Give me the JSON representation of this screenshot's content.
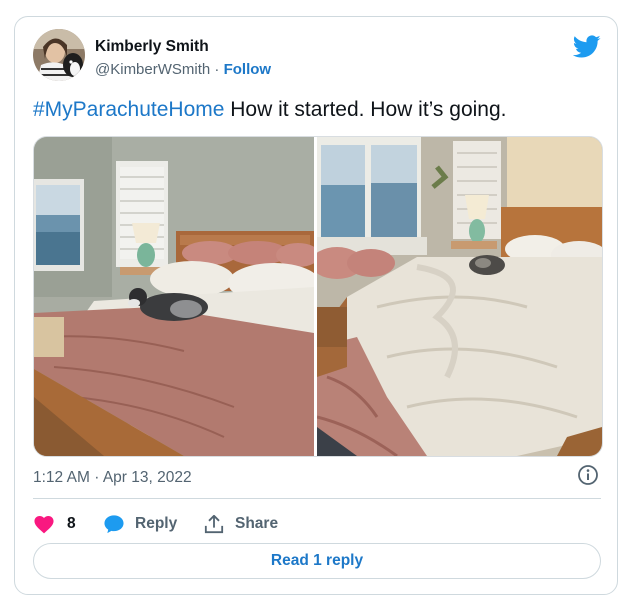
{
  "author": {
    "name": "Kimberly Smith",
    "handle": "@KimberWSmith",
    "separator": "·",
    "follow_label": "Follow"
  },
  "tweet": {
    "hashtag": "#MyParachuteHome",
    "text": " How it started. How it’s going."
  },
  "timestamp": {
    "time": "1:12 AM",
    "separator": "·",
    "date": "Apr 13, 2022"
  },
  "actions": {
    "like_count": "8",
    "reply_label": "Reply",
    "share_label": "Share"
  },
  "read_replies_label": "Read 1 reply",
  "colors": {
    "link": "#1d78c8",
    "twitter_blue": "#1d9bf0",
    "like_red": "#f91880",
    "muted": "#536471",
    "border": "#cfd9de"
  },
  "icons": [
    "twitter-bird-icon",
    "info-icon",
    "heart-icon",
    "reply-bubble-icon",
    "share-icon"
  ]
}
